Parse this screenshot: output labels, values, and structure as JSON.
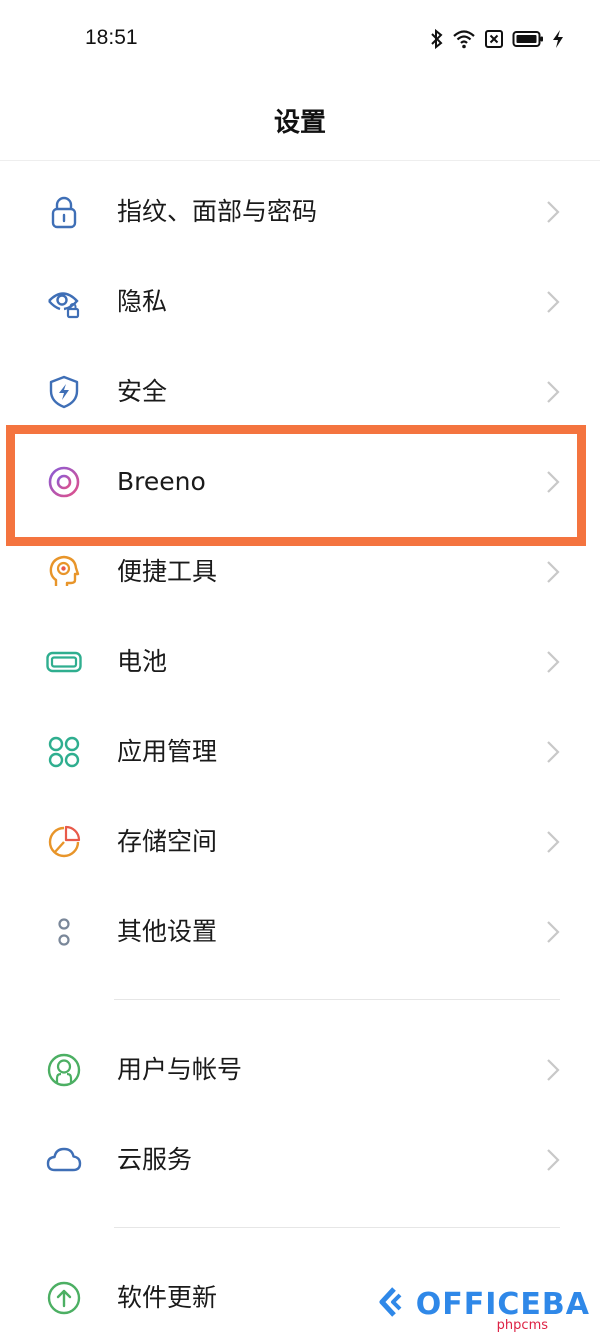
{
  "status_bar": {
    "time": "18:51"
  },
  "header": {
    "title": "设置"
  },
  "groups": [
    {
      "items": [
        {
          "label": "指纹、面部与密码",
          "icon": "lock-icon",
          "color": "#3f6fb6"
        },
        {
          "label": "隐私",
          "icon": "privacy-eye-icon",
          "color": "#3f6fb6"
        },
        {
          "label": "安全",
          "icon": "shield-icon",
          "color": "#3f6fb6"
        },
        {
          "label": "Breeno",
          "icon": "breeno-icon",
          "color": "#b84fb0"
        },
        {
          "label": "便捷工具",
          "icon": "head-target-icon",
          "color": "#e8952a"
        },
        {
          "label": "电池",
          "icon": "battery-icon",
          "color": "#2fae8f"
        },
        {
          "label": "应用管理",
          "icon": "apps-grid-icon",
          "color": "#2fae8f"
        },
        {
          "label": "存储空间",
          "icon": "pie-chart-icon",
          "color": "#e8952a"
        },
        {
          "label": "其他设置",
          "icon": "more-dots-icon",
          "color": "#7a8799"
        }
      ]
    },
    {
      "items": [
        {
          "label": "用户与帐号",
          "icon": "user-icon",
          "color": "#4caf63"
        },
        {
          "label": "云服务",
          "icon": "cloud-icon",
          "color": "#3f6fb6"
        }
      ]
    },
    {
      "items": [
        {
          "label": "软件更新",
          "icon": "update-arrow-icon",
          "color": "#4caf63"
        }
      ]
    }
  ],
  "highlight_color": "#f4743f",
  "watermark": {
    "text": "OFFICEBA",
    "sub": "phpcms"
  }
}
